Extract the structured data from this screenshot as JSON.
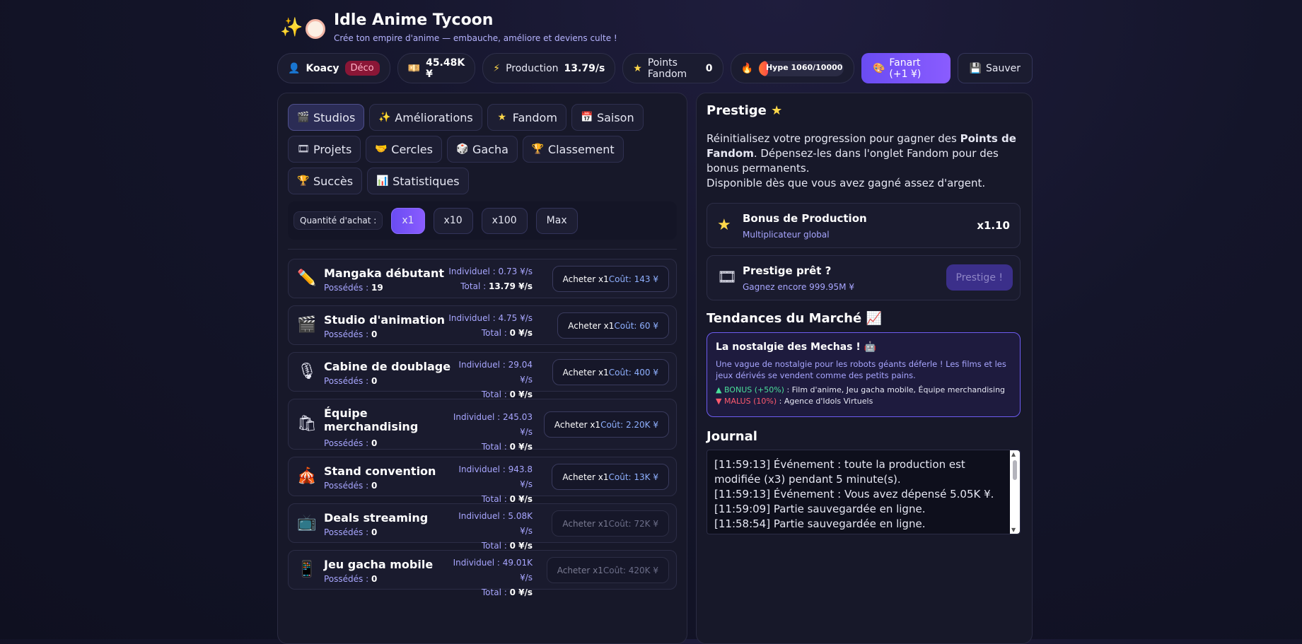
{
  "header": {
    "title": "Idle Anime Tycoon",
    "subtitle": "Crée ton empire d'anime — embauche, améliore et deviens culte !"
  },
  "statbar": {
    "user": "Koacy",
    "logout": "Déco",
    "money": "45.48K ¥",
    "production_label": "Production",
    "production_value": "13.79/s",
    "fandom_label": "Points Fandom",
    "fandom_value": "0",
    "hype": "Hype 1060/10000",
    "hype_fill_fraction": 0.106,
    "fanart_label": "Fanart (+1 ¥)",
    "save_label": "Sauver"
  },
  "tabs": [
    {
      "icon": "🎬",
      "label": "Studios"
    },
    {
      "icon": "✨",
      "label": "Améliorations"
    },
    {
      "icon": "★",
      "label": "Fandom"
    },
    {
      "icon": "📅",
      "label": "Saison"
    },
    {
      "icon": "🎞",
      "label": "Projets"
    },
    {
      "icon": "🤝",
      "label": "Cercles"
    },
    {
      "icon": "🎲",
      "label": "Gacha"
    },
    {
      "icon": "🏆",
      "label": "Classement"
    },
    {
      "icon": "🏆",
      "label": "Succès"
    },
    {
      "icon": "📊",
      "label": "Statistiques"
    }
  ],
  "quantity": {
    "label": "Quantité d'achat :",
    "options": [
      "x1",
      "x10",
      "x100",
      "Max"
    ]
  },
  "items": [
    {
      "name": "Mangaka débutant",
      "owned_label": "Possédés :",
      "owned": "19",
      "ind_label": "Individuel :",
      "ind": "0.73 ¥/s",
      "total_label": "Total :",
      "total": "13.79 ¥/s",
      "buy": "Acheter x1",
      "cost": "Coût: 143 ¥"
    },
    {
      "name": "Studio d'animation",
      "owned_label": "Possédés :",
      "owned": "0",
      "ind_label": "Individuel :",
      "ind": "4.75 ¥/s",
      "total_label": "Total :",
      "total": "0 ¥/s",
      "buy": "Acheter x1",
      "cost": "Coût: 60 ¥"
    },
    {
      "name": "Cabine de doublage",
      "owned_label": "Possédés :",
      "owned": "0",
      "ind_label": "Individuel :",
      "ind": "29.04 ¥/s",
      "total_label": "Total :",
      "total": "0 ¥/s",
      "buy": "Acheter x1",
      "cost": "Coût: 400 ¥"
    },
    {
      "name": "Équipe merchandising",
      "owned_label": "Possédés :",
      "owned": "0",
      "ind_label": "Individuel :",
      "ind": "245.03 ¥/s",
      "total_label": "Total :",
      "total": "0 ¥/s",
      "buy": "Acheter x1",
      "cost": "Coût: 2.20K ¥"
    },
    {
      "name": "Stand convention",
      "owned_label": "Possédés :",
      "owned": "0",
      "ind_label": "Individuel :",
      "ind": "943.8 ¥/s",
      "total_label": "Total :",
      "total": "0 ¥/s",
      "buy": "Acheter x1",
      "cost": "Coût: 13K ¥"
    },
    {
      "name": "Deals streaming",
      "owned_label": "Possédés :",
      "owned": "0",
      "ind_label": "Individuel :",
      "ind": "5.08K ¥/s",
      "total_label": "Total :",
      "total": "0 ¥/s",
      "buy": "Acheter x1",
      "cost": "Coût: 72K ¥"
    },
    {
      "name": "Jeu gacha mobile",
      "owned_label": "Possédés :",
      "owned": "0",
      "ind_label": "Individuel :",
      "ind": "49.01K ¥/s",
      "total_label": "Total :",
      "total": "0 ¥/s",
      "buy": "Acheter x1",
      "cost": "Coût: 420K ¥"
    }
  ],
  "prestige": {
    "title": "Prestige",
    "desc_1": "Réinitialisez votre progression pour gagner des ",
    "desc_bold": "Points de Fandom",
    "desc_2": ". Dépensez-les dans l'onglet Fandom pour des bonus permanents.",
    "desc_3": "Disponible dès que vous avez gagné assez d'argent.",
    "bonus_title": "Bonus de Production",
    "bonus_sub": "Multiplicateur global",
    "bonus_value": "x1.10",
    "ready_title": "Prestige prêt ?",
    "ready_sub": "Gagnez encore 999.95M ¥",
    "ready_button": "Prestige !"
  },
  "market": {
    "title": "Tendances du Marché",
    "trend_title": "La nostalgie des Mechas !",
    "trend_desc": "Une vague de nostalgie pour les robots géants déferle ! Les films et les jeux dérivés se vendent comme des petits pains.",
    "bonus_label": "▲ BONUS (+50%)",
    "bonus_items": " : Film d'anime, Jeu gacha mobile, Équipe merchandising",
    "malus_label": "▼ MALUS (10%)",
    "malus_items": " : Agence d'Idols Virtuels"
  },
  "journal": {
    "title": "Journal",
    "lines": [
      "[11:59:13] Événement : toute la production est modifiée (x3) pendant 5 minute(s).",
      "[11:59:13] Événement : Vous avez dépensé 5.05K ¥.",
      "[11:59:09] Partie sauvegardée en ligne.",
      "[11:58:54] Partie sauvegardée en ligne."
    ]
  }
}
